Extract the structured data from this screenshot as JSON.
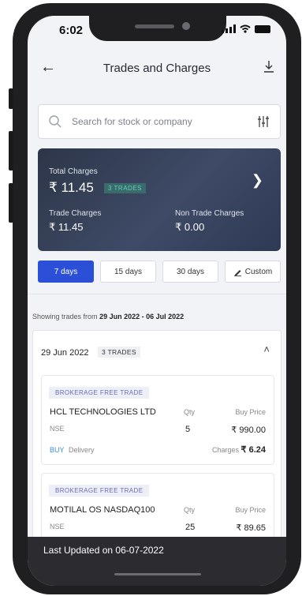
{
  "status_bar": {
    "time": "6:02"
  },
  "header": {
    "title": "Trades and Charges"
  },
  "search": {
    "placeholder": "Search for stock or company"
  },
  "summary": {
    "total_label": "Total Charges",
    "total_value": "₹ 11.45",
    "trades_badge": "3 TRADES",
    "trade_charges_label": "Trade Charges",
    "trade_charges_value": "₹ 11.45",
    "non_trade_charges_label": "Non Trade Charges",
    "non_trade_charges_value": "₹ 0.00"
  },
  "periods": [
    {
      "label": "7 days",
      "active": true
    },
    {
      "label": "15 days"
    },
    {
      "label": "30 days"
    },
    {
      "label": "Custom"
    }
  ],
  "range": {
    "prefix": "Showing trades from",
    "value": "29 Jun 2022 - 06 Jul 2022"
  },
  "day_group": {
    "date": "29 Jun 2022",
    "badge": "3 TRADES",
    "trades": [
      {
        "tag": "BROKERAGE FREE TRADE",
        "name": "HCL TECHNOLOGIES LTD",
        "exchange": "NSE",
        "qty_label": "Qty",
        "qty": "5",
        "price_label": "Buy Price",
        "price": "₹ 990.00",
        "side": "BUY",
        "product": "Delivery",
        "charges_label": "Charges",
        "charges": "₹ 6.24"
      },
      {
        "tag": "BROKERAGE FREE TRADE",
        "name": "MOTILAL OS NASDAQ100",
        "exchange": "NSE",
        "qty_label": "Qty",
        "qty": "25",
        "price_label": "Buy Price",
        "price": "₹ 89.65"
      }
    ]
  },
  "footer": {
    "text": "Last Updated on 06-07-2022"
  },
  "colors": {
    "accent": "#2b4fd6",
    "card_dark": "#2d3648",
    "buy": "#3a8de0",
    "footer_bg": "#2b2b30"
  }
}
